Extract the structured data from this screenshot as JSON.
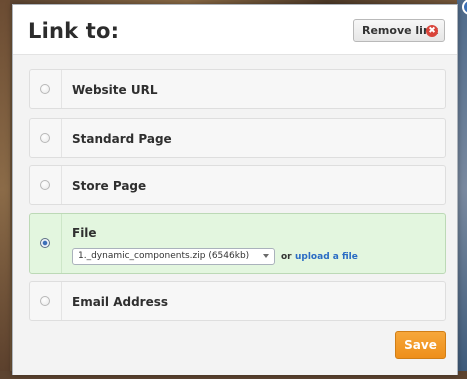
{
  "dialog": {
    "title": "Link to:",
    "remove_link_label": "Remove link",
    "remove_icon": "✖",
    "save_label": "Save"
  },
  "options": [
    {
      "label": "Website URL",
      "selected": false
    },
    {
      "label": "Standard Page",
      "selected": false
    },
    {
      "label": "Store Page",
      "selected": false
    },
    {
      "label": "File",
      "selected": true
    },
    {
      "label": "Email Address",
      "selected": false
    }
  ],
  "file": {
    "selected_value": "1._dynamic_components.zip (6546kb)",
    "or_text": "or",
    "upload_link_label": "upload a file"
  },
  "colors": {
    "accent": "#ee8f1a",
    "selected_bg": "#e3f6df",
    "link": "#2a6cc4"
  }
}
